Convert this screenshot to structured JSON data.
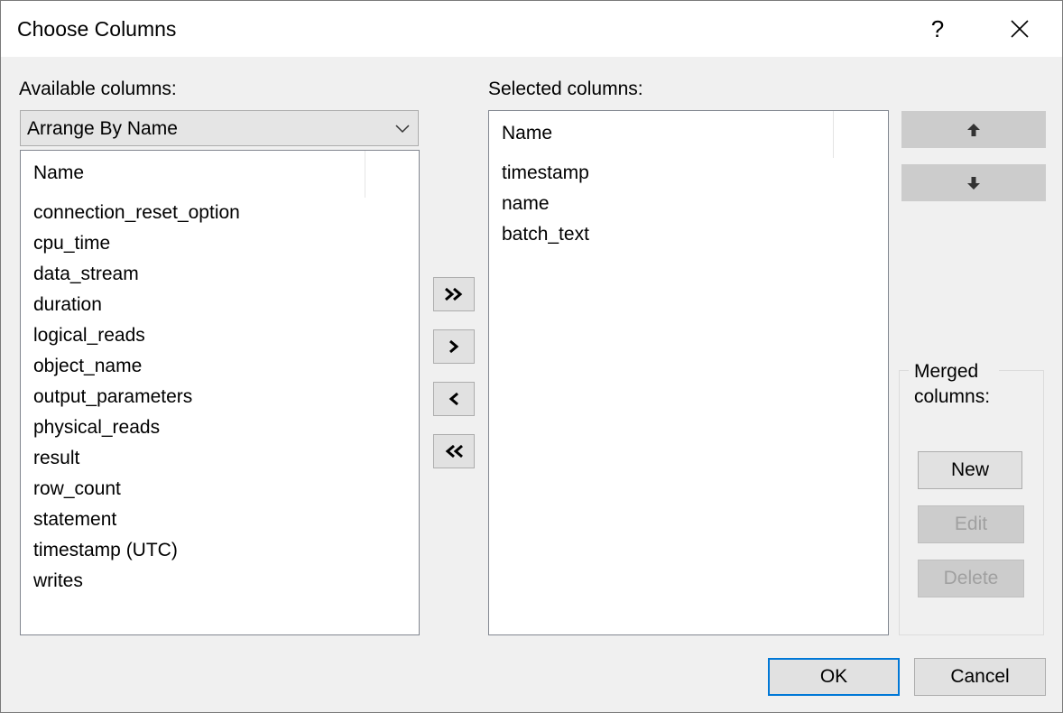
{
  "window": {
    "title": "Choose Columns",
    "help_label": "?"
  },
  "available": {
    "label": "Available columns:",
    "arrange_value": "Arrange By Name",
    "header": "Name",
    "items": [
      "connection_reset_option",
      "cpu_time",
      "data_stream",
      "duration",
      "logical_reads",
      "object_name",
      "output_parameters",
      "physical_reads",
      "result",
      "row_count",
      "statement",
      "timestamp (UTC)",
      "writes"
    ]
  },
  "selected": {
    "label": "Selected columns:",
    "header": "Name",
    "items": [
      "timestamp",
      "name",
      "batch_text"
    ]
  },
  "move_buttons": {
    "add_all": "add-all",
    "add": "add",
    "remove": "remove",
    "remove_all": "remove-all"
  },
  "order_buttons": {
    "up_icon": "arrow-up-icon",
    "down_icon": "arrow-down-icon"
  },
  "merged": {
    "label": "Merged columns:",
    "new_label": "New",
    "edit_label": "Edit",
    "delete_label": "Delete"
  },
  "footer": {
    "ok_label": "OK",
    "cancel_label": "Cancel"
  },
  "colors": {
    "dialog_bg": "#f0f0f0",
    "accent": "#0078d7",
    "disabled_text": "#a0a0a0"
  }
}
